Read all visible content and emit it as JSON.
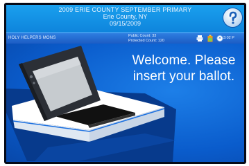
{
  "header": {
    "line1": "2009 ERIE COUNTY SEPTEMBER PRIMARY",
    "line2": "Erie County, NY",
    "line3": "09/15/2009"
  },
  "status_bar": {
    "precinct": "HOLY HELPERS MONS",
    "public_count": "Public Count: 33",
    "protected_count": "Protected Count: 120",
    "clock": "3:02 P"
  },
  "main": {
    "welcome_line1": "Welcome. Please",
    "welcome_line2": "insert your ballot."
  },
  "icons": {
    "help": "help-icon",
    "status": [
      "printer-icon",
      "battery-icon",
      "network-icon"
    ]
  },
  "colors": {
    "header_bg": "#1aa0ee",
    "status_bar_bg": "#2e7ee0",
    "main_bg": "#0a5ccc",
    "text": "#ffffff"
  }
}
